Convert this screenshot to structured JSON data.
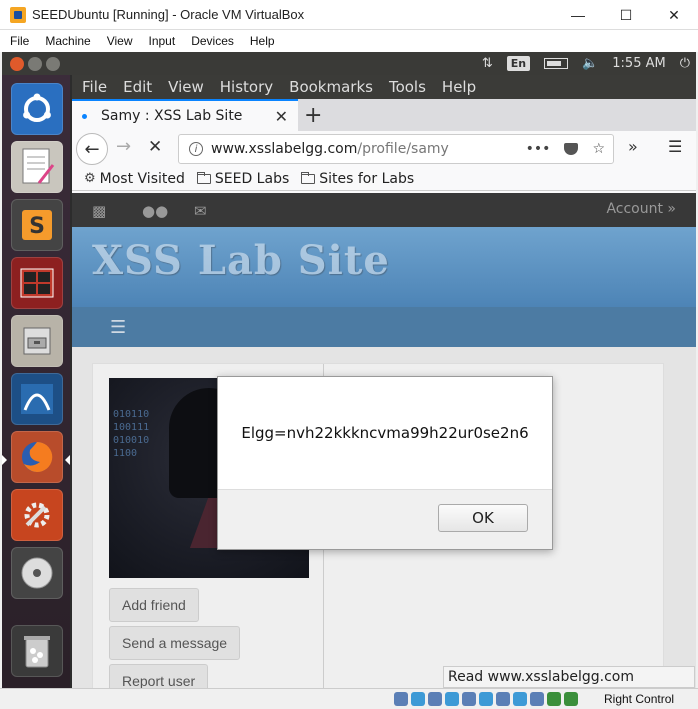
{
  "vbox": {
    "title": "SEEDUbuntu [Running] - Oracle VM VirtualBox",
    "menu": [
      "File",
      "Machine",
      "View",
      "Input",
      "Devices",
      "Help"
    ],
    "host_key": "Right Control"
  },
  "ubuntu": {
    "keyboard_layout": "En",
    "clock": "1:55 AM",
    "launcher_apps": [
      "ubuntu-dash-icon",
      "text-editor-icon",
      "sublime-text-icon",
      "terminal-icon",
      "file-manager-icon",
      "wireshark-icon",
      "firefox-icon",
      "system-settings-icon",
      "dvd-icon",
      "trash-icon"
    ]
  },
  "firefox": {
    "menu": [
      "File",
      "Edit",
      "View",
      "History",
      "Bookmarks",
      "Tools",
      "Help"
    ],
    "tab_title": "Samy : XSS Lab Site",
    "url_domain": "www.xsslabelgg.com",
    "url_path": "/profile/samy",
    "bookmarks": [
      "Most Visited",
      "SEED Labs",
      "Sites for Labs"
    ],
    "status_text": "Read www.xsslabelgg.com"
  },
  "site": {
    "account_label": "Account »",
    "title": "XSS Lab Site",
    "buttons": [
      "Add friend",
      "Send a message",
      "Report user"
    ]
  },
  "dialog": {
    "message": "Elgg=nvh22kkkncvma99h22ur0se2n6",
    "ok_label": "OK"
  }
}
